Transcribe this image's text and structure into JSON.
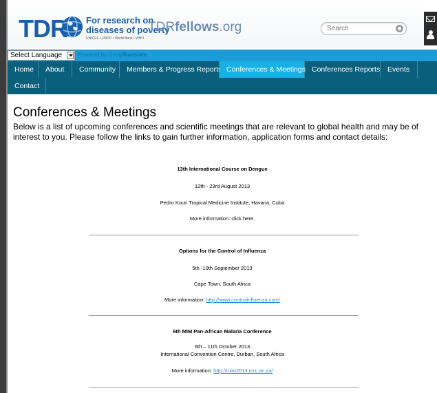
{
  "header": {
    "logo_tdr": "TDR",
    "logo_line1": "For research on",
    "logo_line2": "diseases of poverty",
    "logo_sub": "UNICEF • UNDP • World Bank • WHO",
    "site_name_prefix": "TDR",
    "site_name_bold": "fellows",
    "site_name_suffix": ".org",
    "search_placeholder": "Search"
  },
  "translate": {
    "select_label": "Select Language",
    "powered_by": "Powered by Google",
    "translate_link": "Translate"
  },
  "nav": {
    "items": [
      {
        "label": "Home"
      },
      {
        "label": "About"
      },
      {
        "label": "Community"
      },
      {
        "label": "Members & Progress Reports"
      },
      {
        "label": "Conferences & Meetings"
      },
      {
        "label": "Conferences Reports"
      },
      {
        "label": "Events"
      },
      {
        "label": "Contact"
      }
    ],
    "active": "Conferences & Meetings"
  },
  "content": {
    "title": "Conferences & Meetings",
    "intro": "Below is a list of upcoming conferences and scientific meetings that are relevant to global health and may be of interest to you. Please follow the links to gain further information, application forms and contact details:",
    "events": [
      {
        "title": "13th International Course on Dengue",
        "dates": "12th - 23rd August 2013",
        "location": "Pedro Kouri Tropical Medicine Institute, Havana, Cuba",
        "more_label": "More information: ",
        "link": "click here."
      },
      {
        "title": "Options for the Control of Influenza",
        "dates": "5th -10th September 2013",
        "location": "Cape Town, South Africa",
        "more_label": "More information: ",
        "link": "http://www.controlinfluenza.com/"
      },
      {
        "title": "6th MIM Pan-African Malaria Conference",
        "dates": "6th – 11th October 2013",
        "location": "International Convention Centre, Durban, South Africa",
        "more_label": "More information: ",
        "link": "http://mim2013.mrc.ac.za/"
      }
    ]
  },
  "colors": {
    "nav_bg": "#0a5f7d",
    "nav_active": "#17b1e6",
    "translate_bar": "#1b9bd7",
    "link": "#1a8fd6",
    "logo_blue": "#1b5fa8"
  }
}
